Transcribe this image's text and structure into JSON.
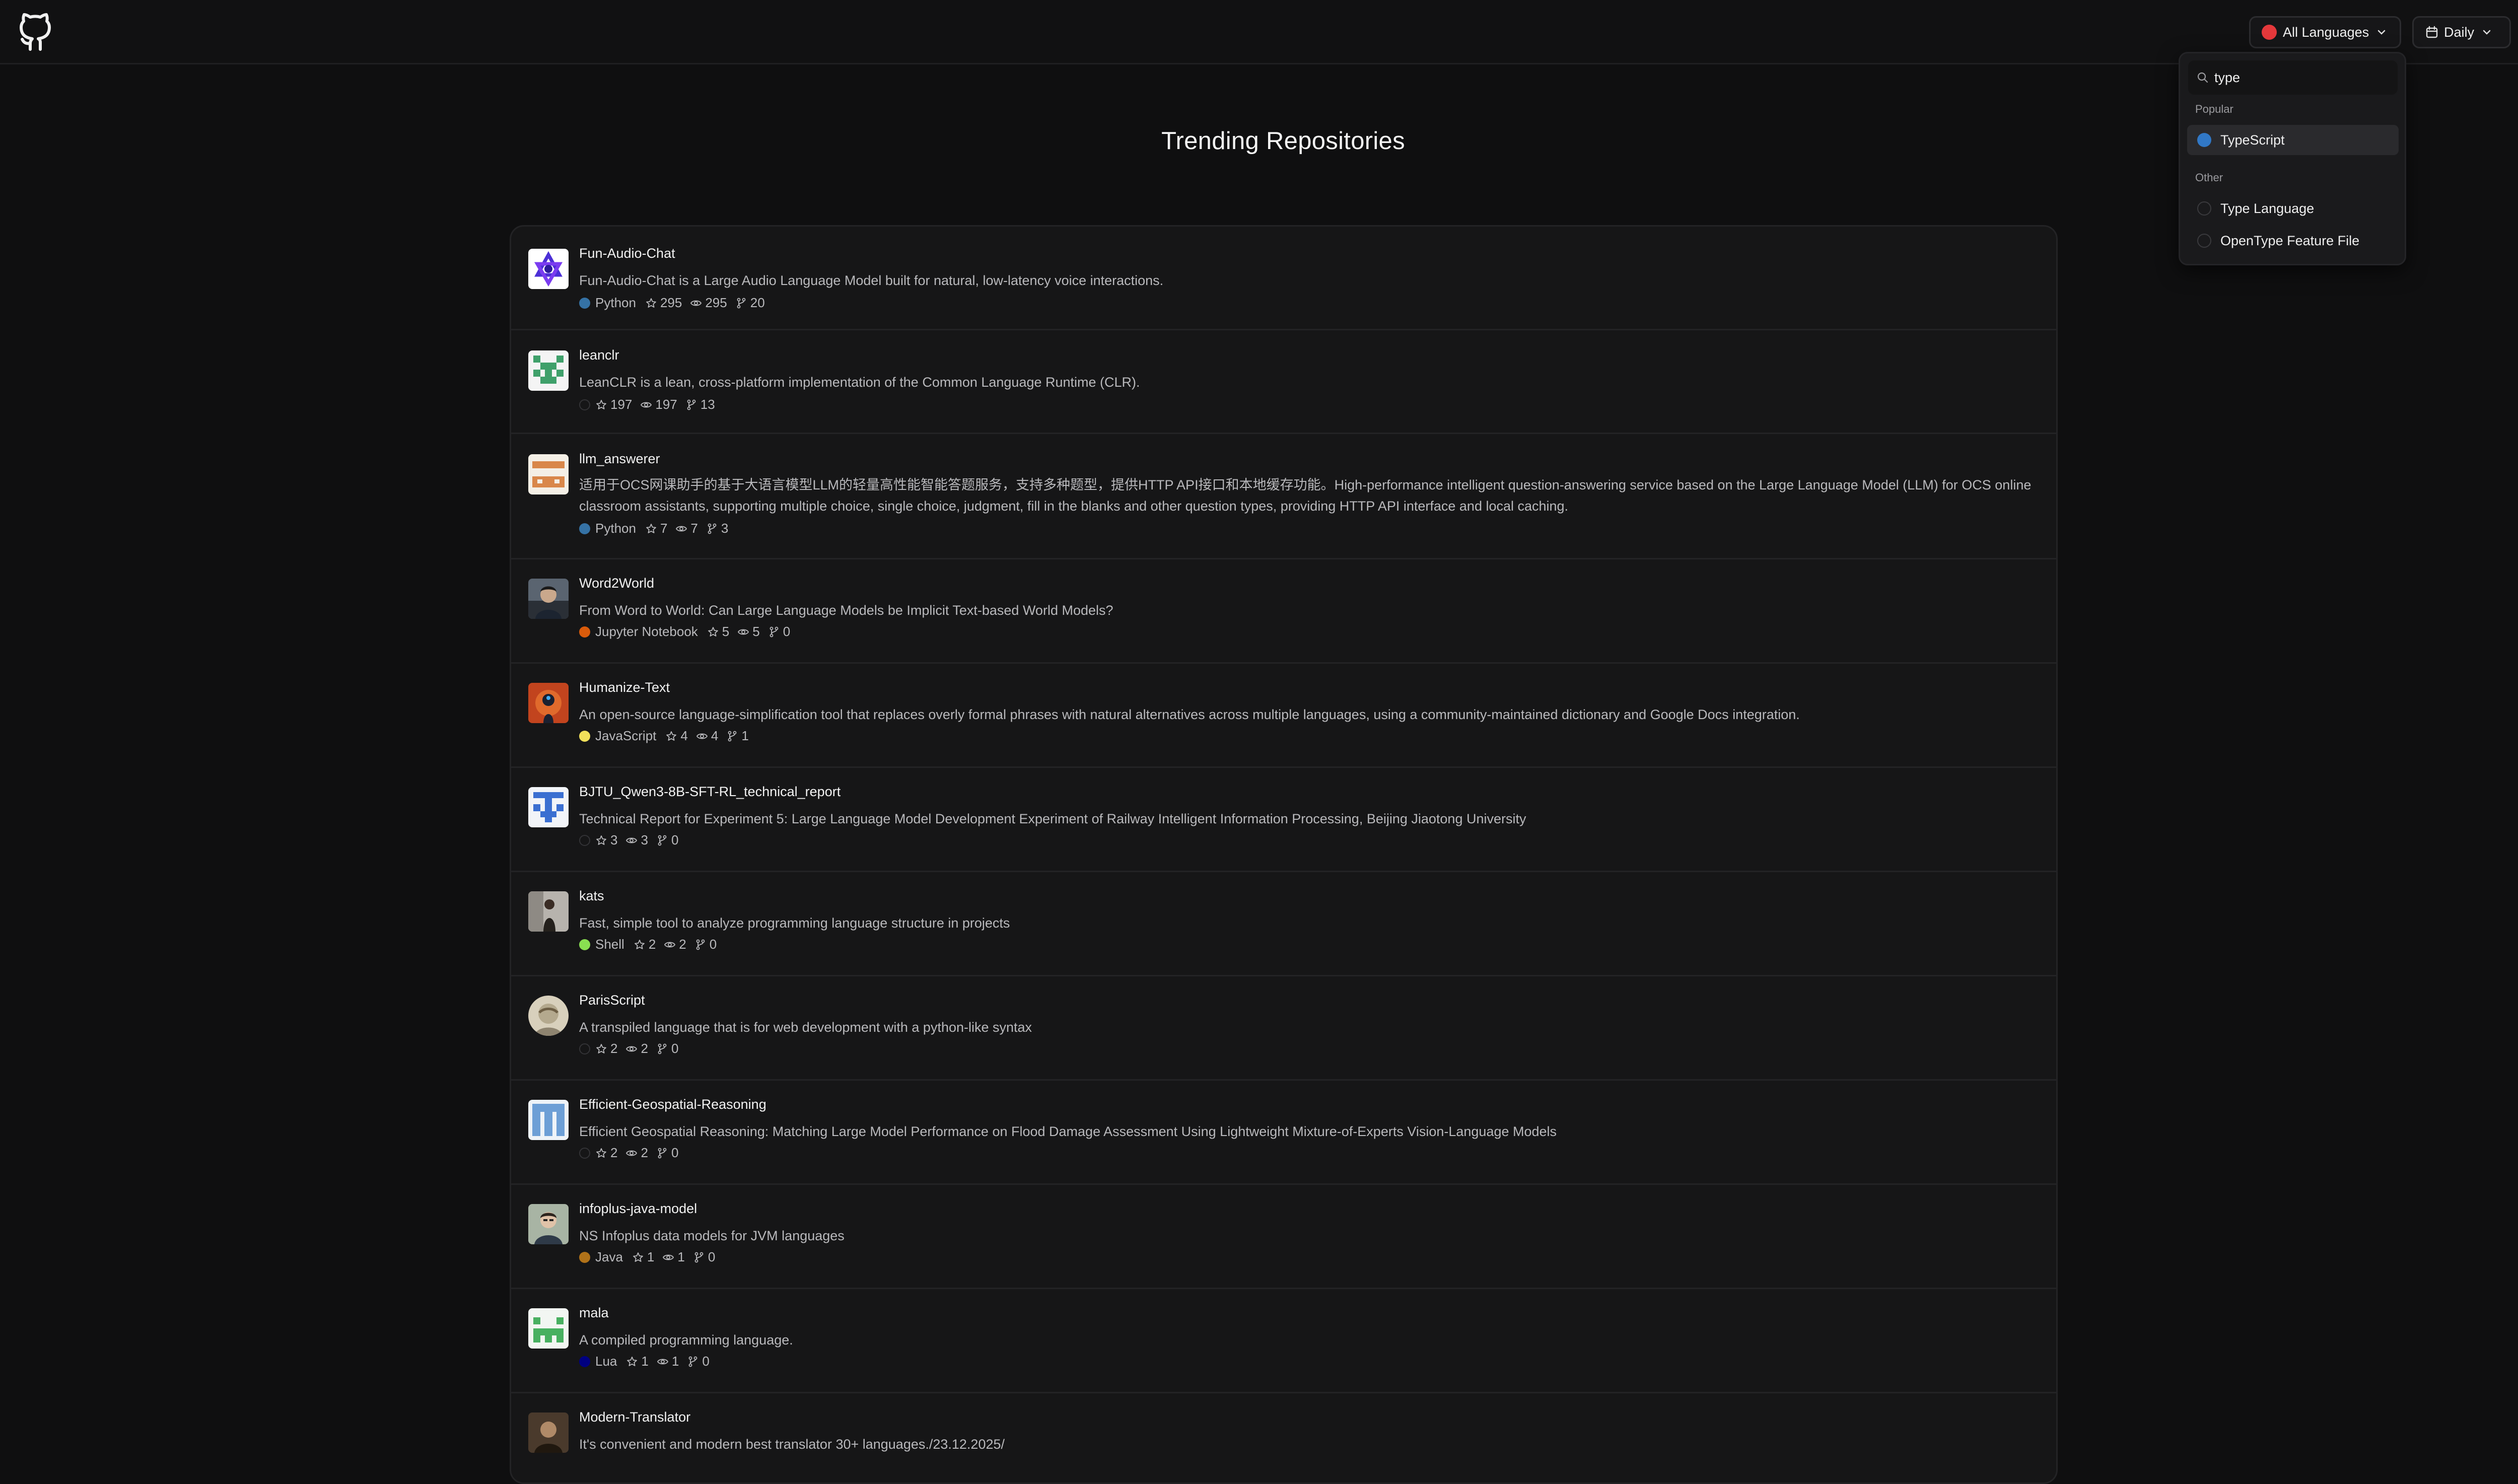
{
  "header": {
    "language_button": "All Languages",
    "period_button": "Daily"
  },
  "page_title": "Trending Repositories",
  "repos": [
    {
      "name": "Fun-Audio-Chat",
      "description": "Fun-Audio-Chat is a Large Audio Language Model built for natural, low-latency voice interactions.",
      "language": "Python",
      "language_color": "#3572A5",
      "stars": "295",
      "watchers": "295",
      "forks": "20"
    },
    {
      "name": "leanclr",
      "description": "LeanCLR is a lean, cross-platform implementation of the Common Language Runtime (CLR).",
      "language": "",
      "language_color": "",
      "stars": "197",
      "watchers": "197",
      "forks": "13"
    },
    {
      "name": "llm_answerer",
      "description": "适用于OCS网课助手的基于大语言模型LLM的轻量高性能智能答题服务，支持多种题型，提供HTTP API接口和本地缓存功能。High-performance intelligent question-answering service based on the Large Language Model (LLM) for OCS online classroom assistants, supporting multiple choice, single choice, judgment, fill in the blanks and other question types, providing HTTP API interface and local caching.",
      "language": "Python",
      "language_color": "#3572A5",
      "stars": "7",
      "watchers": "7",
      "forks": "3"
    },
    {
      "name": "Word2World",
      "description": "From Word to World: Can Large Language Models be Implicit Text-based World Models?",
      "language": "Jupyter Notebook",
      "language_color": "#DA5B0B",
      "stars": "5",
      "watchers": "5",
      "forks": "0"
    },
    {
      "name": "Humanize-Text",
      "description": "An open-source language-simplification tool that replaces overly formal phrases with natural alternatives across multiple languages, using a community-maintained dictionary and Google Docs integration.",
      "language": "JavaScript",
      "language_color": "#F1E05A",
      "stars": "4",
      "watchers": "4",
      "forks": "1"
    },
    {
      "name": "BJTU_Qwen3-8B-SFT-RL_technical_report",
      "description": "Technical Report for Experiment 5: Large Language Model Development Experiment of Railway Intelligent Information Processing, Beijing Jiaotong University",
      "language": "",
      "language_color": "",
      "stars": "3",
      "watchers": "3",
      "forks": "0"
    },
    {
      "name": "kats",
      "description": "Fast, simple tool to analyze programming language structure in projects",
      "language": "Shell",
      "language_color": "#89E051",
      "stars": "2",
      "watchers": "2",
      "forks": "0"
    },
    {
      "name": "ParisScript",
      "description": "A transpiled language that is for web development with a python-like syntax",
      "language": "",
      "language_color": "",
      "stars": "2",
      "watchers": "2",
      "forks": "0"
    },
    {
      "name": "Efficient-Geospatial-Reasoning",
      "description": "Efficient Geospatial Reasoning: Matching Large Model Performance on Flood Damage Assessment Using Lightweight Mixture-of-Experts Vision-Language Models",
      "language": "",
      "language_color": "",
      "stars": "2",
      "watchers": "2",
      "forks": "0"
    },
    {
      "name": "infoplus-java-model",
      "description": "NS Infoplus data models for JVM languages",
      "language": "Java",
      "language_color": "#B07219",
      "stars": "1",
      "watchers": "1",
      "forks": "0"
    },
    {
      "name": "mala",
      "description": "A compiled programming language.",
      "language": "Lua",
      "language_color": "#000080",
      "stars": "1",
      "watchers": "1",
      "forks": "0"
    },
    {
      "name": "Modern-Translator",
      "description": "It's convenient and modern best translator 30+ languages./23.12.2025/",
      "language": "",
      "language_color": "",
      "stars": "",
      "watchers": "",
      "forks": ""
    }
  ],
  "language_dropdown": {
    "search_value": "type",
    "popular_label": "Popular",
    "other_label": "Other",
    "popular": [
      {
        "label": "TypeScript",
        "color": "#3178C6"
      }
    ],
    "other": [
      {
        "label": "Type Language"
      },
      {
        "label": "OpenType Feature File"
      }
    ]
  },
  "colors": {
    "accent_red": "#E5383B",
    "background": "#0F0F10",
    "card": "#161617"
  }
}
